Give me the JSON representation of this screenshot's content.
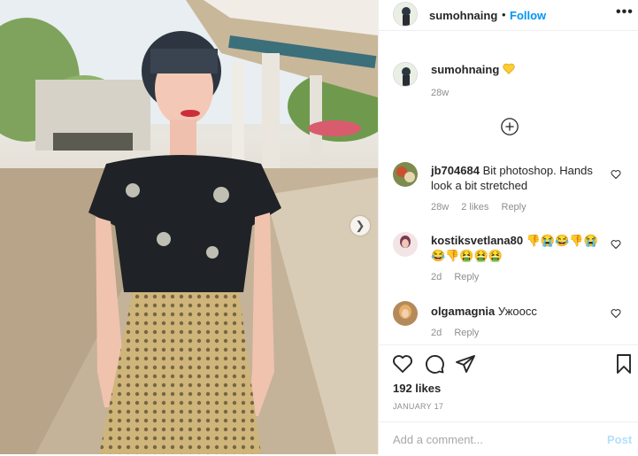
{
  "photo": {
    "alt_icons": {
      "next": "chevron-right-icon"
    }
  },
  "header": {
    "username": "sumohnaing",
    "bullet": "•",
    "follow_label": "Follow",
    "more_label": "•••"
  },
  "caption": {
    "username": "sumohnaing",
    "emoji": "yellow-heart-icon",
    "time": "28w"
  },
  "comments": [
    {
      "username": "jb704684",
      "text": "Bit photoshop. Hands look a bit stretched",
      "time": "28w",
      "likes": "2 likes",
      "reply": "Reply"
    },
    {
      "username": "kostiksvetlana80",
      "text": "👎😭😂👎😭 😂👎🤮🤮🤮",
      "time": "2d",
      "reply": "Reply"
    },
    {
      "username": "olgamagnia",
      "text": "Ужоосс",
      "time": "2d",
      "reply": "Reply"
    }
  ],
  "actions": {
    "likes": "192 likes",
    "date": "JANUARY 17",
    "icons": [
      "heart-icon",
      "comment-icon",
      "share-icon",
      "bookmark-icon"
    ]
  },
  "comment_box": {
    "placeholder": "Add a comment...",
    "post_label": "Post"
  },
  "colors": {
    "link": "#0095f6",
    "muted": "#8e8e8e",
    "post_disabled": "#b2dffc"
  }
}
